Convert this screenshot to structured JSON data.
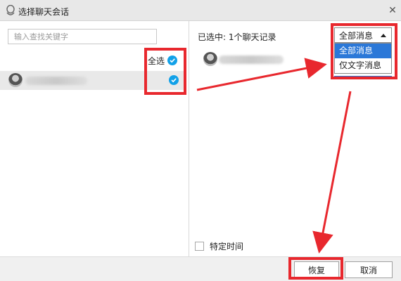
{
  "window": {
    "title": "选择聊天会话",
    "close_icon": "close-icon",
    "app_icon": "penguin-icon"
  },
  "left": {
    "search_placeholder": "输入查找关键字",
    "search_value": "",
    "select_all_label": "全选",
    "select_all_checked": true,
    "contacts": [
      {
        "name": "",
        "checked": true,
        "avatar": "avatar"
      }
    ]
  },
  "right": {
    "selected_label": "已选中: 1个聊天记录",
    "filter": {
      "selected": "全部消息",
      "options": [
        "全部消息",
        "仅文字消息"
      ]
    },
    "records": [
      {
        "name": "",
        "avatar": "avatar"
      }
    ],
    "specific_time_label": "特定时间",
    "specific_time_checked": false
  },
  "footer": {
    "restore_label": "恢复",
    "cancel_label": "取消"
  },
  "colors": {
    "accent": "#12a1e8",
    "highlight": "#2b78d8",
    "annotation": "#e8282e"
  }
}
